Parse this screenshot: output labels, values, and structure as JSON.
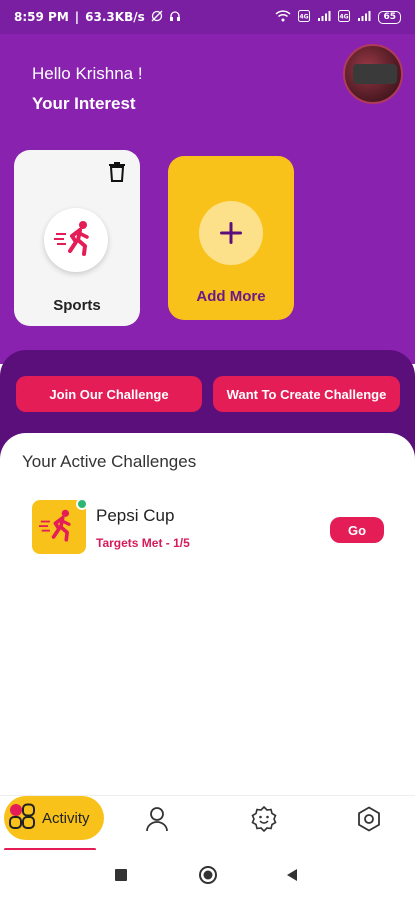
{
  "status_bar": {
    "time": "8:59 PM",
    "speed": "63.3KB/s",
    "battery": "65"
  },
  "header": {
    "greeting": "Hello Krishna  !",
    "subtitle": "Your Interest"
  },
  "interests": [
    {
      "label": "Sports",
      "icon": "running-person-icon"
    },
    {
      "label": "Add More",
      "icon": "plus-icon"
    }
  ],
  "actions": {
    "join_label": "Join Our Challenge",
    "create_label": "Want To Create Challenge"
  },
  "active_challenges": {
    "title": "Your Active Challenges",
    "items": [
      {
        "name": "Pepsi Cup",
        "meta": "Targets Met - 1/5",
        "button": "Go"
      }
    ]
  },
  "bottom_nav": {
    "items": [
      {
        "label": "Activity",
        "icon": "activity-icon",
        "active": true
      },
      {
        "label": "",
        "icon": "profile-icon",
        "active": false
      },
      {
        "label": "",
        "icon": "badge-icon",
        "active": false
      },
      {
        "label": "",
        "icon": "settings-icon",
        "active": false
      }
    ]
  },
  "colors": {
    "primary_purple": "#8a22b0",
    "dark_purple": "#5b0f7a",
    "accent_yellow": "#f8c21b",
    "accent_pink": "#e41d57"
  }
}
